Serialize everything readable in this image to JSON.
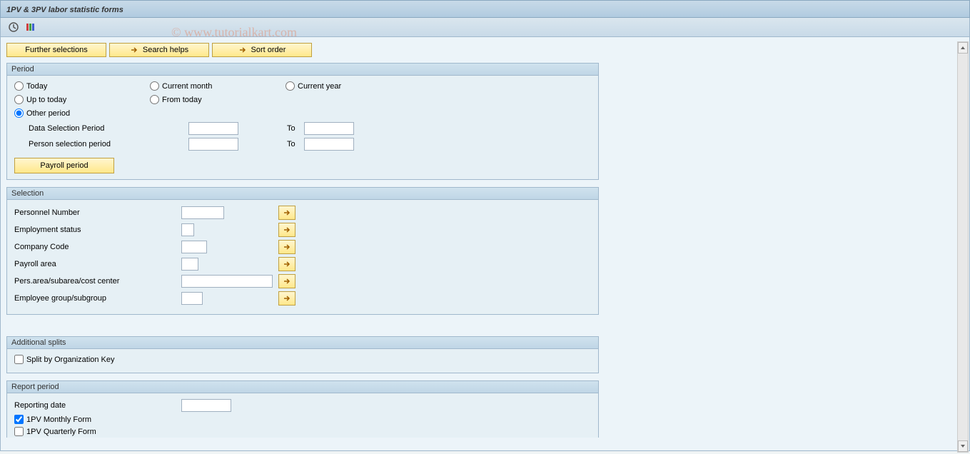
{
  "title": "1PV & 3PV labor statistic forms",
  "watermark": "© www.tutorialkart.com",
  "buttons": {
    "further_selections": "Further selections",
    "search_helps": "Search helps",
    "sort_order": "Sort order"
  },
  "period": {
    "title": "Period",
    "today": "Today",
    "current_month": "Current month",
    "current_year": "Current year",
    "up_to_today": "Up to today",
    "from_today": "From today",
    "other_period": "Other period",
    "data_selection": "Data Selection Period",
    "person_selection": "Person selection period",
    "to": "To",
    "payroll_period": "Payroll period"
  },
  "selection": {
    "title": "Selection",
    "personnel_number": "Personnel Number",
    "employment_status": "Employment status",
    "company_code": "Company Code",
    "payroll_area": "Payroll area",
    "pers_area": "Pers.area/subarea/cost center",
    "employee_group": "Employee group/subgroup"
  },
  "additional_splits": {
    "title": "Additional splits",
    "split_by_org": "Split by Organization Key"
  },
  "report_period": {
    "title": "Report period",
    "reporting_date": "Reporting date",
    "monthly_form": "1PV Monthly Form",
    "quarterly_form": "1PV Quarterly Form"
  }
}
